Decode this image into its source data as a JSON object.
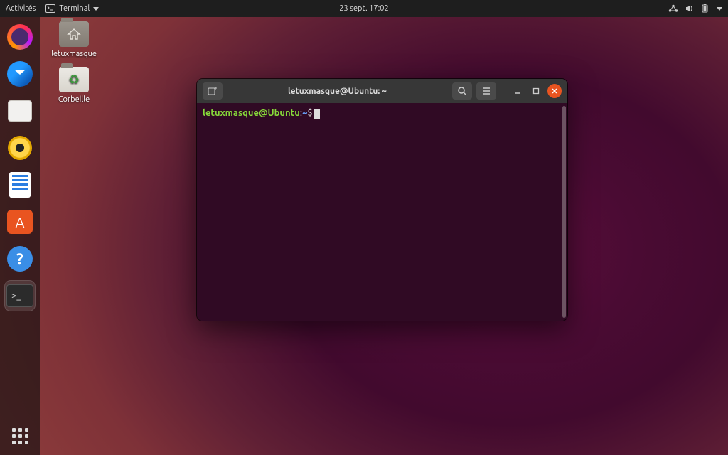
{
  "topbar": {
    "activities": "Activités",
    "app_menu_label": "Terminal",
    "datetime": "23 sept.  17:02"
  },
  "desktop_icons": {
    "home_label": "letuxmasque",
    "trash_label": "Corbeille"
  },
  "dock": {
    "items": [
      {
        "name": "firefox"
      },
      {
        "name": "thunderbird"
      },
      {
        "name": "files"
      },
      {
        "name": "rhythmbox"
      },
      {
        "name": "libreoffice-writer"
      },
      {
        "name": "ubuntu-software"
      },
      {
        "name": "help"
      },
      {
        "name": "terminal",
        "active": true
      }
    ]
  },
  "terminal": {
    "title": "letuxmasque@Ubuntu: ~",
    "prompt_user_host": "letuxmasque@Ubuntu",
    "prompt_separator": ":",
    "prompt_path": "~",
    "prompt_symbol": "$"
  },
  "colors": {
    "ubuntu_orange": "#e95420",
    "terminal_bg": "#300a24",
    "prompt_green": "#87d93a",
    "prompt_blue": "#6aa6ff"
  }
}
